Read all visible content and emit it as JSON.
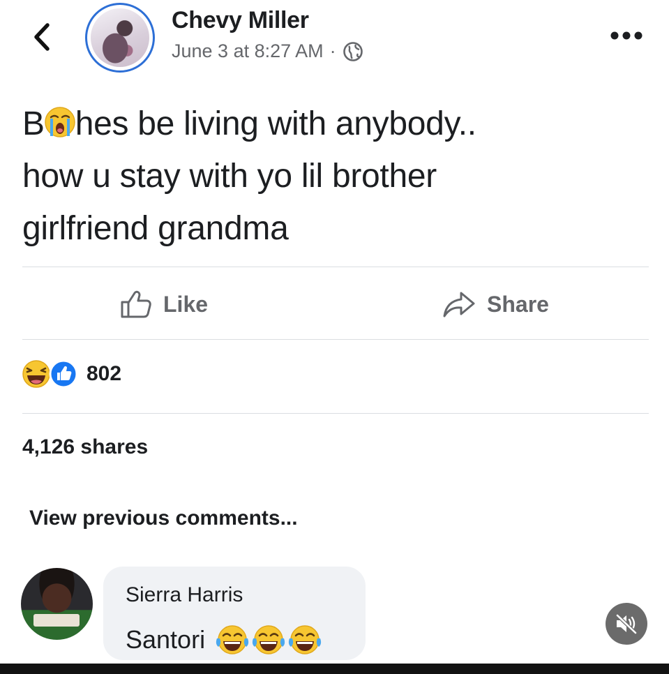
{
  "header": {
    "author": "Chevy Miller",
    "date": "June 3 at 8:27 AM",
    "separator": "·",
    "audience_icon": "globe-icon"
  },
  "post": {
    "lines": [
      {
        "before": "B",
        "emoji": "loudly-crying-face-emoji",
        "after": "hes be living with anybody.."
      },
      {
        "text": "how u stay with yo lil brother"
      },
      {
        "text": "girlfriend grandma"
      }
    ]
  },
  "actions": {
    "like_label": "Like",
    "share_label": "Share"
  },
  "reactions": {
    "icons": [
      "laughing-reaction-icon",
      "like-reaction-icon"
    ],
    "count": "802"
  },
  "shares": "4,126 shares",
  "view_previous": "View previous comments...",
  "comment": {
    "author": "Sierra Harris",
    "text": "Santori",
    "emojis": [
      "tears-of-joy-emoji",
      "tears-of-joy-emoji",
      "tears-of-joy-emoji"
    ]
  },
  "colors": {
    "text": "#1c1e21",
    "secondary": "#65676b",
    "avatar_ring": "#2d6fd6",
    "like_blue": "#1877f2",
    "bubble": "#f0f2f5",
    "emoji_yellow": "#f7c631"
  },
  "icons": {
    "back": "chevron-left-icon",
    "more": "more-options-icon",
    "mute": "muted-speaker-icon"
  }
}
